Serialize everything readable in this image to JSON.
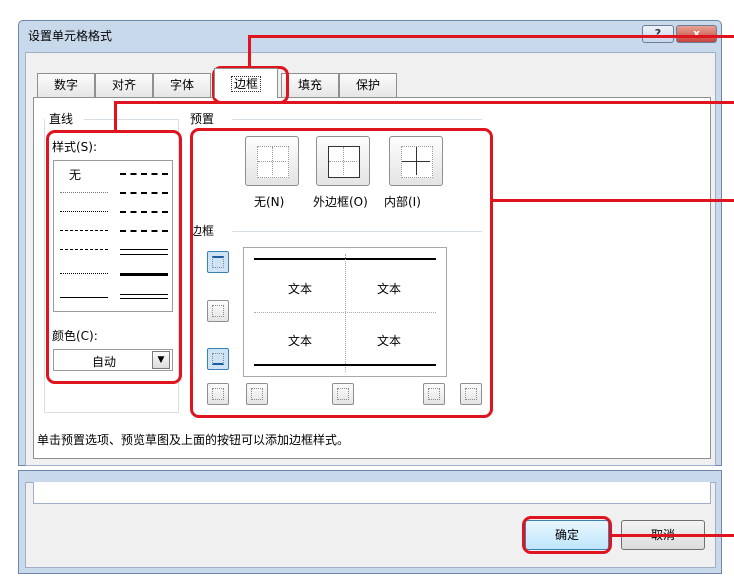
{
  "window": {
    "title": "设置单元格格式",
    "help_label": "?",
    "close_label": "x"
  },
  "tabs": [
    {
      "label": "数字",
      "active": false
    },
    {
      "label": "对齐",
      "active": false
    },
    {
      "label": "字体",
      "active": false
    },
    {
      "label": "边框",
      "active": true
    },
    {
      "label": "填充",
      "active": false
    },
    {
      "label": "保护",
      "active": false
    }
  ],
  "line_group": {
    "title": "直线",
    "style_label": "样式(S):",
    "style_label_key": "S",
    "none_label": "无",
    "color_label": "颜色(C):",
    "color_label_key": "C",
    "color_value": "自动"
  },
  "presets": {
    "title": "预置",
    "items": [
      {
        "label": "无(N)",
        "key": "N"
      },
      {
        "label": "外边框(O)",
        "key": "O"
      },
      {
        "label": "内部(I)",
        "key": "I"
      }
    ]
  },
  "border": {
    "title": "边框",
    "preview_texts": [
      "文本",
      "文本",
      "文本",
      "文本"
    ]
  },
  "hint": "单击预置选项、预览草图及上面的按钮可以添加边框样式。",
  "buttons": {
    "ok": "确定",
    "cancel": "取消"
  },
  "colors": {
    "highlight": "#e0141f",
    "selected_button": "#cfe3f7",
    "window_frame": "#c9d9ec"
  }
}
